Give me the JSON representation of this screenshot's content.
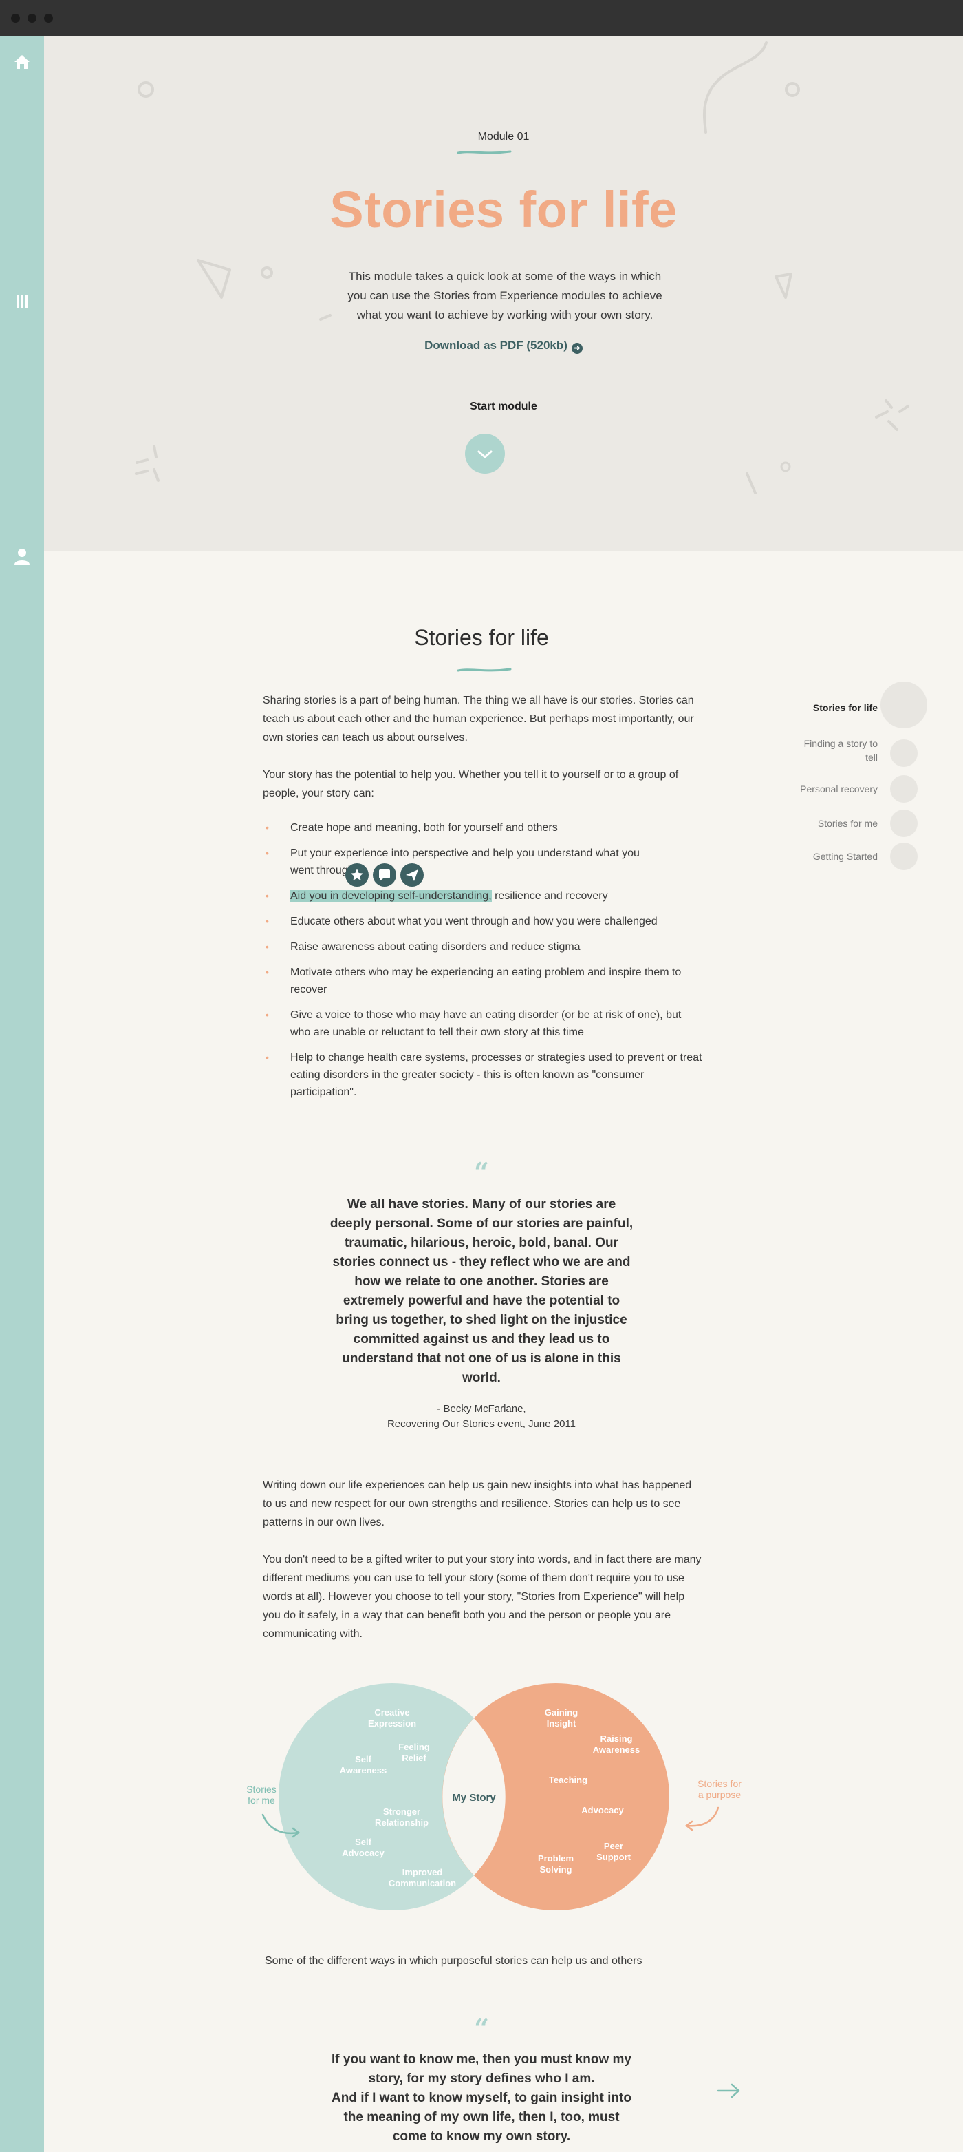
{
  "sidebar": {
    "icons": [
      "home-icon",
      "menu-icon",
      "user-icon"
    ]
  },
  "hero": {
    "module_label": "Module 01",
    "title": "Stories for life",
    "description_lines": [
      "This module takes a quick look at some of the ways in which",
      "you can use the Stories from Experience modules to achieve",
      "what you want to achieve by working with your own story."
    ],
    "download_label": "Download as PDF (520kb)",
    "start_label": "Start module"
  },
  "content": {
    "title": "Stories for life",
    "intro_1": "Sharing stories is a part of being human. The thing we all have is our stories. Stories can teach us about each other and the human experience. But perhaps most importantly, our own stories can teach us about ourselves.",
    "intro_2": "Your story has the potential to help you. Whether you tell it to yourself or to a group of people, your story can:",
    "bullets": [
      "Create hope and meaning, both for yourself and others",
      "Put your experience into perspective and help you understand what you",
      "went through",
      "Aid you in developing self-understanding,",
      " resilience and recovery",
      "Educate others about what you went through and how you were challenged",
      "Raise awareness about eating disorders and reduce stigma",
      "Motivate others who may be experiencing an eating problem and inspire them to recover",
      "Give a voice to those who may have an eating disorder (or be at risk of one), but who are unable or reluctant to tell their own story at this time",
      "Help to change health care systems, processes or strategies used to prevent or treat eating disorders in the greater society - this is often known as \"consumer participation\"."
    ],
    "quote_1": {
      "mark": "“",
      "text": "We all have stories. Many of our stories are deeply personal. Some of our stories are painful, traumatic, hilarious, heroic, bold, banal. Our stories connect us - they reflect who we are and how we relate to one another. Stories are extremely powerful and have the potential to bring us together, to shed light on the injustice committed against us and they lead us to understand that not one of us is alone in this world.",
      "author": "-  Becky McFarlane,",
      "source": "Recovering Our Stories event, June 2011"
    },
    "para_3": "Writing down our life experiences can help us gain new insights into what has happened to us and new respect for our own strengths and resilience. Stories can help us to see patterns in our own lives.",
    "para_4": "You don't need to be a gifted writer to put your story into words, and in fact there are many different mediums you can use to tell your story (some of them don't require you to use words at all). However you choose to tell your story, \"Stories from Experience\" will help you do it safely, in a way that can benefit both you and the person or people you are communicating with.",
    "venn": {
      "center": "My Story",
      "left_label": [
        "Stories",
        "for me"
      ],
      "right_label": [
        "Stories for",
        "a purpose"
      ],
      "left_items": [
        [
          "Creative",
          "Expression"
        ],
        [
          "Feeling",
          "Relief"
        ],
        [
          "Self",
          "Awareness"
        ],
        [
          "Stronger",
          "Relationship"
        ],
        [
          "Self",
          "Advocacy"
        ],
        [
          "Improved",
          "Communication"
        ]
      ],
      "right_items": [
        [
          "Gaining",
          "Insight"
        ],
        [
          "Raising",
          "Awareness"
        ],
        [
          "Teaching"
        ],
        [
          "Advocacy"
        ],
        [
          "Peer",
          "Support"
        ],
        [
          "Problem",
          "Solving"
        ]
      ],
      "colors": {
        "left": "#c3dfd9",
        "right": "#f0ab87"
      }
    },
    "venn_caption": "Some of the different ways in which purposeful stories can help us and others",
    "quote_2": {
      "mark": "“",
      "lines": [
        "If you want to know me, then you must know my",
        "story, for my story defines who I am.",
        "And if I want to know myself, to gain insight into",
        "the meaning of my own life, then I, too, must",
        "come to know my own story."
      ]
    }
  },
  "toc": {
    "items": [
      {
        "label": "Stories for life",
        "active": true
      },
      {
        "label": "Finding a story to tell",
        "active": false
      },
      {
        "label": "Personal recovery",
        "active": false
      },
      {
        "label": "Stories for me",
        "active": false
      },
      {
        "label": "Getting Started",
        "active": false
      }
    ]
  },
  "colors": {
    "accent": "#f1aa85",
    "teal": "#aed5ce",
    "dark_teal": "#3d6062"
  }
}
